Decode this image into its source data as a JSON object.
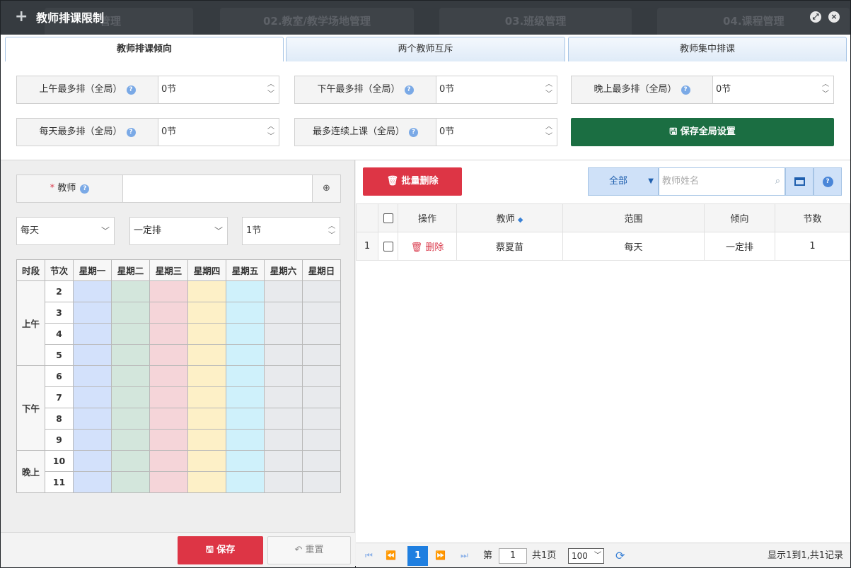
{
  "background_tabs": [
    "管理",
    "02.教室/教学场地管理",
    "03.班级管理",
    "04.课程管理"
  ],
  "window": {
    "title": "教师排课限制"
  },
  "tabs": [
    {
      "label": "教师排课倾向",
      "active": true
    },
    {
      "label": "两个教师互斥",
      "active": false
    },
    {
      "label": "教师集中排课",
      "active": false
    }
  ],
  "global": {
    "fields": [
      {
        "label": "上午最多排（全局）",
        "value": "0节"
      },
      {
        "label": "下午最多排（全局）",
        "value": "0节"
      },
      {
        "label": "晚上最多排（全局）",
        "value": "0节"
      },
      {
        "label": "每天最多排（全局）",
        "value": "0节"
      },
      {
        "label": "最多连续上课（全局）",
        "value": "0节"
      }
    ],
    "save_label": "保存全局设置"
  },
  "form": {
    "required_mark": "*",
    "teacher_label": "教师",
    "teacher_value": "",
    "scope": "每天",
    "tendency": "一定排",
    "count": "1节"
  },
  "schedule": {
    "headers": [
      "时段",
      "节次",
      "星期一",
      "星期二",
      "星期三",
      "星期四",
      "星期五",
      "星期六",
      "星期日"
    ],
    "periods": [
      {
        "name": "上午",
        "slots": [
          "2",
          "3",
          "4",
          "5"
        ]
      },
      {
        "name": "下午",
        "slots": [
          "6",
          "7",
          "8",
          "9"
        ]
      },
      {
        "name": "晚上",
        "slots": [
          "10",
          "11"
        ]
      }
    ]
  },
  "left_footer": {
    "save_label": "保存",
    "reset_label": "重置"
  },
  "toolbar": {
    "batch_delete_label": "批量删除",
    "filter_value": "全部",
    "search_placeholder": "教师姓名"
  },
  "grid": {
    "columns": [
      "操作",
      "教师",
      "范围",
      "倾向",
      "节数"
    ],
    "rows": [
      {
        "index": "1",
        "action": "删除",
        "teacher": "蔡夏苗",
        "scope": "每天",
        "tendency": "一定排",
        "count": "1"
      }
    ]
  },
  "pager": {
    "current": "1",
    "page_prefix": "第",
    "page_input": "1",
    "page_total": "共1页",
    "page_size": "100",
    "summary": "显示1到1,共1记录"
  }
}
